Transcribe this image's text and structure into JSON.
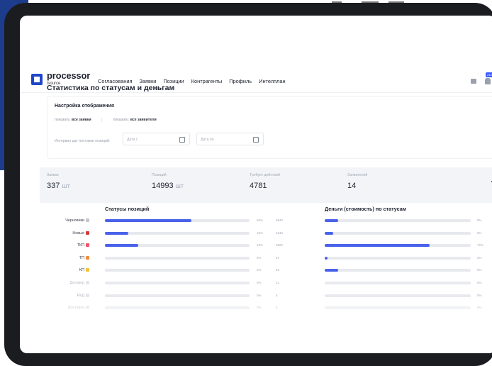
{
  "app": {
    "logo_name": "processor",
    "logo_sub": "isource"
  },
  "nav": {
    "items": [
      "Согласования",
      "Заявки",
      "Позиции",
      "Контрагенты",
      "Профиль",
      "Интелплан"
    ]
  },
  "header": {
    "badge": "249"
  },
  "page": {
    "title": "Статистика по статусам и деньгам"
  },
  "settings": {
    "title": "Настройка отображения",
    "show_requests_prefix": "показать:",
    "show_requests_value": "все заявки",
    "show_applicants_prefix": "показать:",
    "show_applicants_value": "все заявители",
    "interval_label": "Интервал дат поставки позиций:",
    "date_from_placeholder": "Дата с",
    "date_to_placeholder": "Дата по"
  },
  "stats": [
    {
      "label": "Заявок",
      "value": "337",
      "unit": "шт"
    },
    {
      "label": "Позиций",
      "value": "14993",
      "unit": "шт"
    },
    {
      "label": "Требует действий",
      "value": "4781",
      "unit": ""
    },
    {
      "label": "Заявителей",
      "value": "14",
      "unit": ""
    }
  ],
  "positions_chart": {
    "title": "Статусы позиций",
    "rows": [
      {
        "label": "Черновики",
        "color": "#c5c8ce",
        "fraction": 0.6,
        "pct": "60%",
        "count": "6940",
        "muted": false
      },
      {
        "label": "Новые",
        "color": "#d23b3b",
        "fraction": 0.16,
        "pct": "15%",
        "count": "2343",
        "muted": false
      },
      {
        "label": "ТКП",
        "color": "#f0546a",
        "fraction": 0.23,
        "pct": "23%",
        "count": "3523",
        "muted": false
      },
      {
        "label": "ТП",
        "color": "#f08d3a",
        "fraction": 0,
        "pct": "0%",
        "count": "57",
        "muted": false
      },
      {
        "label": "КП",
        "color": "#f2c23a",
        "fraction": 0,
        "pct": "0%",
        "count": "53",
        "muted": false
      },
      {
        "label": "Договор",
        "color": "#e3e5ea",
        "fraction": 0,
        "pct": "0%",
        "count": "11",
        "muted": true
      },
      {
        "label": "РКД",
        "color": "#e3e5ea",
        "fraction": 0,
        "pct": "0%",
        "count": "5",
        "muted": true
      },
      {
        "label": "Доставка",
        "color": "#e3e5ea",
        "fraction": 0,
        "pct": "0%",
        "count": "6",
        "muted": true
      }
    ]
  },
  "money_chart": {
    "title": "Деньги (стоимость) по статусам",
    "rows": [
      {
        "fraction": 0.09,
        "pct": "9%"
      },
      {
        "fraction": 0.06,
        "pct": "6%"
      },
      {
        "fraction": 0.72,
        "pct": "72%"
      },
      {
        "fraction": 0.02,
        "pct": "2%"
      },
      {
        "fraction": 0.09,
        "pct": "9%"
      },
      {
        "fraction": 0,
        "pct": "0%"
      },
      {
        "fraction": 0,
        "pct": "0%"
      },
      {
        "fraction": 0,
        "pct": "0%"
      }
    ]
  }
}
